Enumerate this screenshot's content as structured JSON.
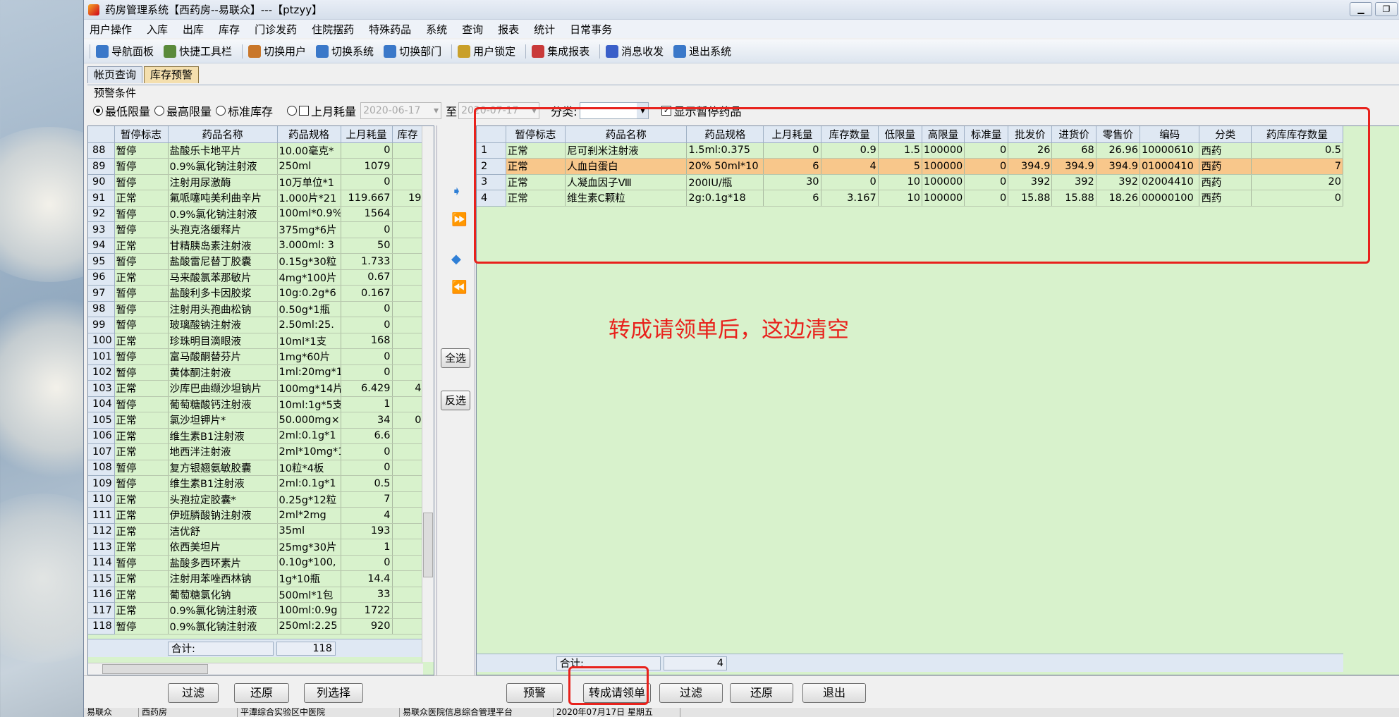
{
  "window": {
    "title": "药房管理系统【西药房--易联众】---【ptzyy】"
  },
  "menu": [
    "用户操作",
    "入库",
    "出库",
    "库存",
    "门诊发药",
    "住院摆药",
    "特殊药品",
    "系统",
    "查询",
    "报表",
    "统计",
    "日常事务"
  ],
  "toolbar": [
    {
      "label": "导航面板",
      "icon": "navigation-panel-icon",
      "color": "#3a78c9"
    },
    {
      "label": "快捷工具栏",
      "icon": "quick-toolbar-icon",
      "color": "#5a8a3a"
    },
    {
      "label": "切换用户",
      "icon": "switch-user-icon",
      "color": "#c9772a"
    },
    {
      "label": "切换系统",
      "icon": "switch-system-icon",
      "color": "#3a78c9"
    },
    {
      "label": "切换部门",
      "icon": "switch-department-icon",
      "color": "#3a78c9"
    },
    {
      "label": "用户锁定",
      "icon": "user-lock-icon",
      "color": "#c9a02a"
    },
    {
      "label": "集成报表",
      "icon": "integrated-report-icon",
      "color": "#c93a3a"
    },
    {
      "label": "消息收发",
      "icon": "message-icon",
      "color": "#3a5fc9"
    },
    {
      "label": "退出系统",
      "icon": "exit-system-icon",
      "color": "#3a78c9"
    }
  ],
  "tabs": [
    "帐页查询",
    "库存预警"
  ],
  "filter": {
    "legend": "预警条件",
    "options": [
      "最低限量",
      "最高限量",
      "标准库存",
      "上月耗量"
    ],
    "date_from": "2020-06-17",
    "to_label": "至",
    "date_to": "2020-07-17",
    "category_label": "分类:",
    "category_value": "",
    "show_paused_label": "显示暂停药品"
  },
  "left_grid": {
    "columns": [
      "暂停标志",
      "药品名称",
      "药品规格",
      "上月耗量",
      "库存"
    ],
    "rows": [
      [
        "88",
        "暂停",
        "盐酸乐卡地平片",
        "10.00毫克*",
        "0",
        ""
      ],
      [
        "89",
        "暂停",
        "0.9%氯化钠注射液",
        "250ml",
        "1079",
        ""
      ],
      [
        "90",
        "暂停",
        "注射用尿激酶",
        "10万单位*1",
        "0",
        ""
      ],
      [
        "91",
        "正常",
        "氟哌噻吨美利曲辛片",
        "1.000片*21",
        "119.667",
        "19"
      ],
      [
        "92",
        "暂停",
        "0.9%氯化钠注射液",
        "100ml*0.9%",
        "1564",
        ""
      ],
      [
        "93",
        "暂停",
        "头孢克洛缓释片",
        "375mg*6片",
        "0",
        ""
      ],
      [
        "94",
        "正常",
        "甘精胰岛素注射液",
        "3.000ml: 3",
        "50",
        ""
      ],
      [
        "95",
        "暂停",
        "盐酸雷尼替丁胶囊",
        "0.15g*30粒",
        "1.733",
        ""
      ],
      [
        "96",
        "正常",
        "马来酸氯苯那敏片",
        "4mg*100片",
        "0.67",
        ""
      ],
      [
        "97",
        "暂停",
        "盐酸利多卡因胶浆",
        "10g:0.2g*6",
        "0.167",
        ""
      ],
      [
        "98",
        "暂停",
        "注射用头孢曲松钠",
        "0.50g*1瓶",
        "0",
        ""
      ],
      [
        "99",
        "暂停",
        "玻璃酸钠注射液",
        "2.50ml:25.",
        "0",
        ""
      ],
      [
        "100",
        "正常",
        "珍珠明目滴眼液",
        "10ml*1支",
        "168",
        ""
      ],
      [
        "101",
        "暂停",
        "富马酸酮替芬片",
        "1mg*60片",
        "0",
        ""
      ],
      [
        "102",
        "暂停",
        "黄体酮注射液",
        "1ml:20mg*1",
        "0",
        ""
      ],
      [
        "103",
        "正常",
        "沙库巴曲缬沙坦钠片",
        "100mg*14片",
        "6.429",
        "4"
      ],
      [
        "104",
        "暂停",
        "葡萄糖酸钙注射液",
        "10ml:1g*5支",
        "1",
        ""
      ],
      [
        "105",
        "正常",
        "氯沙坦钾片*",
        "50.000mg×",
        "34",
        "0"
      ],
      [
        "106",
        "正常",
        "维生素B1注射液",
        "2ml:0.1g*1",
        "6.6",
        ""
      ],
      [
        "107",
        "正常",
        "地西泮注射液",
        "2ml*10mg*1",
        "0",
        ""
      ],
      [
        "108",
        "暂停",
        "复方银翘氨敏胶囊",
        "10粒*4板",
        "0",
        ""
      ],
      [
        "109",
        "暂停",
        "维生素B1注射液",
        "2ml:0.1g*1",
        "0.5",
        ""
      ],
      [
        "110",
        "正常",
        "头孢拉定胶囊*",
        "0.25g*12粒",
        "7",
        ""
      ],
      [
        "111",
        "正常",
        "伊班膦酸钠注射液",
        "2ml*2mg",
        "4",
        ""
      ],
      [
        "112",
        "正常",
        "洁优舒",
        "35ml",
        "193",
        ""
      ],
      [
        "113",
        "正常",
        "依西美坦片",
        "25mg*30片",
        "1",
        ""
      ],
      [
        "114",
        "暂停",
        "盐酸多西环素片",
        "0.10g*100,",
        "0",
        ""
      ],
      [
        "115",
        "正常",
        "注射用苯唑西林钠",
        "1g*10瓶",
        "14.4",
        ""
      ],
      [
        "116",
        "正常",
        "葡萄糖氯化钠",
        "500ml*1包",
        "33",
        ""
      ],
      [
        "117",
        "正常",
        "0.9%氯化钠注射液",
        "100ml:0.9g",
        "1722",
        ""
      ],
      [
        "118",
        "暂停",
        "0.9%氯化钠注射液",
        "250ml:2.25",
        "920",
        ""
      ]
    ],
    "sum_label": "合计:",
    "sum_value": "118"
  },
  "right_grid": {
    "columns": [
      "暂停标志",
      "药品名称",
      "药品规格",
      "上月耗量",
      "库存数量",
      "低限量",
      "高限量",
      "标准量",
      "批发价",
      "进货价",
      "零售价",
      "编码",
      "分类",
      "药库库存数量"
    ],
    "rows": [
      [
        "1",
        "正常",
        "尼可刹米注射液",
        "1.5ml:0.375",
        "0",
        "0.9",
        "1.5",
        "100000",
        "0",
        "26",
        "68",
        "26.96",
        "10000610",
        "西药",
        "0.5"
      ],
      [
        "2",
        "正常",
        "人血白蛋白",
        "20% 50ml*10",
        "6",
        "4",
        "5",
        "100000",
        "0",
        "394.9",
        "394.9",
        "394.9",
        "01000410",
        "西药",
        "7"
      ],
      [
        "3",
        "正常",
        "人凝血因子Ⅷ",
        "200IU/瓶",
        "30",
        "0",
        "10",
        "100000",
        "0",
        "392",
        "392",
        "392",
        "02004410",
        "西药",
        "20"
      ],
      [
        "4",
        "正常",
        "维生素C颗粒",
        "2g:0.1g*18",
        "6",
        "3.167",
        "10",
        "100000",
        "0",
        "15.88",
        "15.88",
        "18.26",
        "00000100",
        "西药",
        "0"
      ]
    ],
    "selected_row": 1,
    "sum_label": "合计:",
    "sum_value": "4"
  },
  "middle": {
    "select_all": "全选",
    "invert": "反选"
  },
  "bottom_left_buttons": [
    "过滤",
    "还原",
    "列选择"
  ],
  "bottom_right_buttons": [
    "预警",
    "转成请领单",
    "过滤",
    "还原",
    "退出"
  ],
  "annotation": "转成请领单后，这边清空",
  "status": [
    "易联众",
    "西药房",
    "平潭综合实验区中医院",
    "易联众医院信息综合管理平台",
    "2020年07月17日 星期五"
  ]
}
